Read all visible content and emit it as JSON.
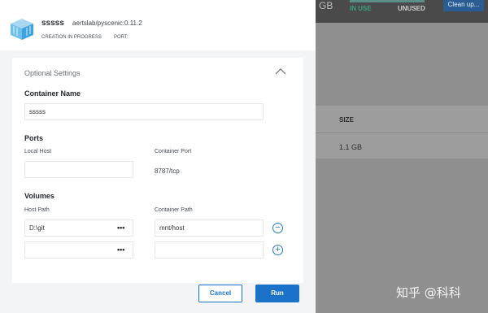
{
  "background": {
    "gb": "GB",
    "in_use": "IN USE",
    "unused": "UNUSED",
    "clean_up": "Clean up...",
    "size_header": "SIZE",
    "size_value": "1.1 GB",
    "watermark": "知乎 @科科"
  },
  "header": {
    "container_name": "sssss",
    "image": "aertslab/pyscenic:0.11.2",
    "status": "CREATION IN PROGRESS",
    "port_label": "PORT:",
    "icon": "container-cube-icon"
  },
  "settings": {
    "title": "Optional Settings",
    "container_name_label": "Container Name",
    "container_name_value": "sssss",
    "ports_label": "Ports",
    "local_host_label": "Local Host",
    "local_host_value": "",
    "container_port_label": "Container Port",
    "container_port_value": "8787/tcp",
    "volumes_label": "Volumes",
    "host_path_label": "Host Path",
    "container_path_label": "Container Path",
    "volumes": [
      {
        "host_path": "D:\\git",
        "container_path": "mnt/host",
        "action": "−"
      },
      {
        "host_path": "",
        "container_path": "",
        "action": "+"
      }
    ],
    "browse": "•••"
  },
  "buttons": {
    "cancel": "Cancel",
    "run": "Run"
  },
  "colors": {
    "accent": "#1a73c9",
    "in_use": "#3aa07f"
  }
}
